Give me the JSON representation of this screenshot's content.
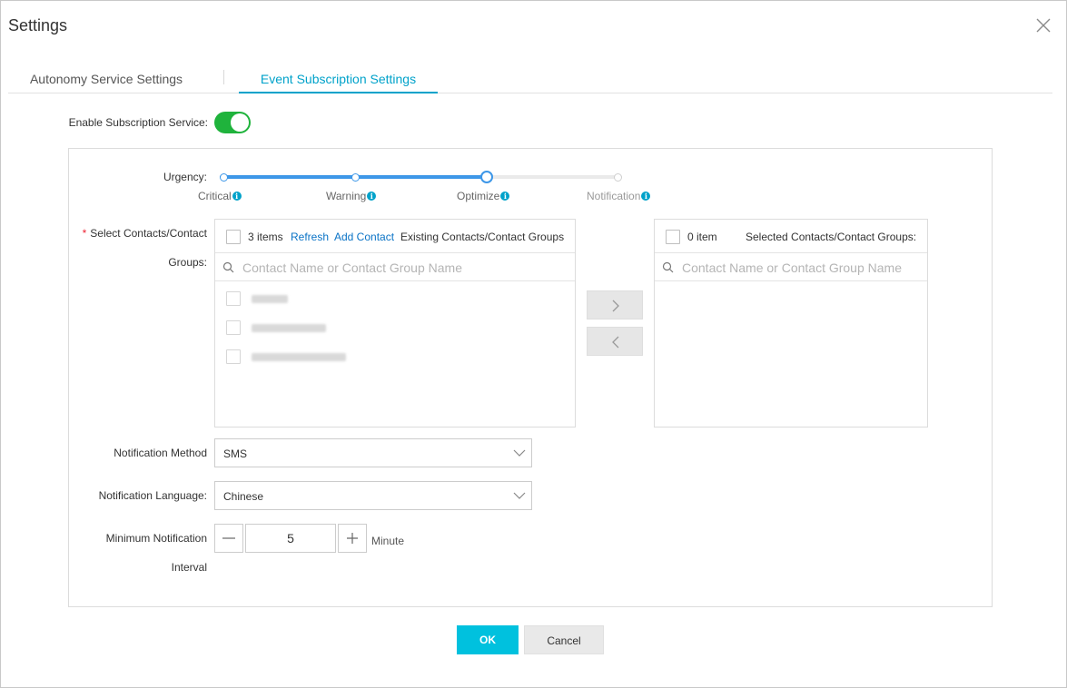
{
  "dialog": {
    "title": "Settings"
  },
  "tabs": [
    {
      "label": "Autonomy Service Settings",
      "active": false
    },
    {
      "label": "Event Subscription Settings",
      "active": true
    }
  ],
  "subscription": {
    "label": "Enable Subscription Service:",
    "enabled": true,
    "toggle_color": "#1fb33c"
  },
  "urgency": {
    "label": "Urgency:",
    "levels": [
      "Critical",
      "Warning",
      "Optimize",
      "Notification"
    ],
    "selected_index": 2,
    "accent": "#3d97e8"
  },
  "contacts": {
    "label_line1": "Select Contacts/Contact",
    "label_line2": "Groups:",
    "left": {
      "count": "3 items",
      "refresh": "Refresh",
      "add": "Add Contact",
      "title": "Existing Contacts/Contact Groups",
      "placeholder": "Contact Name or Contact Group Name",
      "items": [
        "",
        "",
        ""
      ]
    },
    "right": {
      "count": "0 item",
      "title": "Selected Contacts/Contact Groups:",
      "placeholder": "Contact Name or Contact Group Name"
    }
  },
  "notification_method": {
    "label": "Notification Method",
    "value": "SMS"
  },
  "notification_language": {
    "label": "Notification Language:",
    "value": "Chinese"
  },
  "interval": {
    "label_line1": "Minimum Notification",
    "label_line2": "Interval",
    "value": "5",
    "unit": "Minute"
  },
  "footer": {
    "ok": "OK",
    "cancel": "Cancel"
  },
  "colors": {
    "link": "#0a73c6",
    "primary": "#00c1de",
    "tab_active": "#00a2ca"
  }
}
